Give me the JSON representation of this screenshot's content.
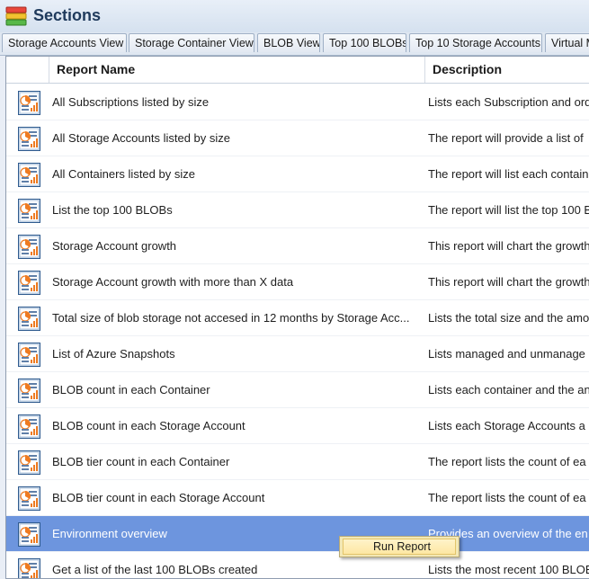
{
  "titlebar": {
    "title": "Sections",
    "icon": "sections-stack-icon"
  },
  "tabs": [
    {
      "label": "Storage Accounts View"
    },
    {
      "label": "Storage Container View"
    },
    {
      "label": "BLOB View"
    },
    {
      "label": "Top 100 BLOBs"
    },
    {
      "label": "Top 10 Storage Accounts"
    },
    {
      "label": "Virtual M"
    }
  ],
  "grid": {
    "columns": {
      "name": "Report Name",
      "description": "Description"
    },
    "row_icon": "report-chart-icon",
    "rows": [
      {
        "name": "All Subscriptions listed by size",
        "description": "Lists each Subscription and ord"
      },
      {
        "name": "All Storage Accounts listed by size",
        "description": "The report will provide a list of"
      },
      {
        "name": "All Containers listed by size",
        "description": "The report will list each contain"
      },
      {
        "name": "List the top 100 BLOBs",
        "description": "The report will list the top 100 B"
      },
      {
        "name": "Storage Account growth",
        "description": "This report will chart the growth"
      },
      {
        "name": "Storage Account growth with more than X data",
        "description": "This report will chart the growth"
      },
      {
        "name": "Total size of blob storage not accesed in 12 months by Storage Acc...",
        "description": "Lists the total size and the amo"
      },
      {
        "name": "List of Azure Snapshots",
        "description": "Lists managed and unmanage"
      },
      {
        "name": "BLOB count in each Container",
        "description": "Lists each container and the an"
      },
      {
        "name": "BLOB count in each Storage Account",
        "description": "Lists each Storage Accounts a"
      },
      {
        "name": "BLOB tier count in each Container",
        "description": "The report lists the count of ea"
      },
      {
        "name": "BLOB tier count in each Storage Account",
        "description": "The report lists the count of ea"
      },
      {
        "name": "Environment overview",
        "description": "Provides an overview of the en"
      },
      {
        "name": "Get a list of the last 100 BLOBs created",
        "description": "Lists the most recent 100 BLOB"
      }
    ],
    "selected_row": "Environment overview"
  },
  "context_menu": {
    "items": [
      {
        "label": "Run Report"
      }
    ]
  },
  "colors": {
    "selection": "#6d95de",
    "menu_background": "#f3e8b5",
    "title_text": "#1f3a5c"
  }
}
